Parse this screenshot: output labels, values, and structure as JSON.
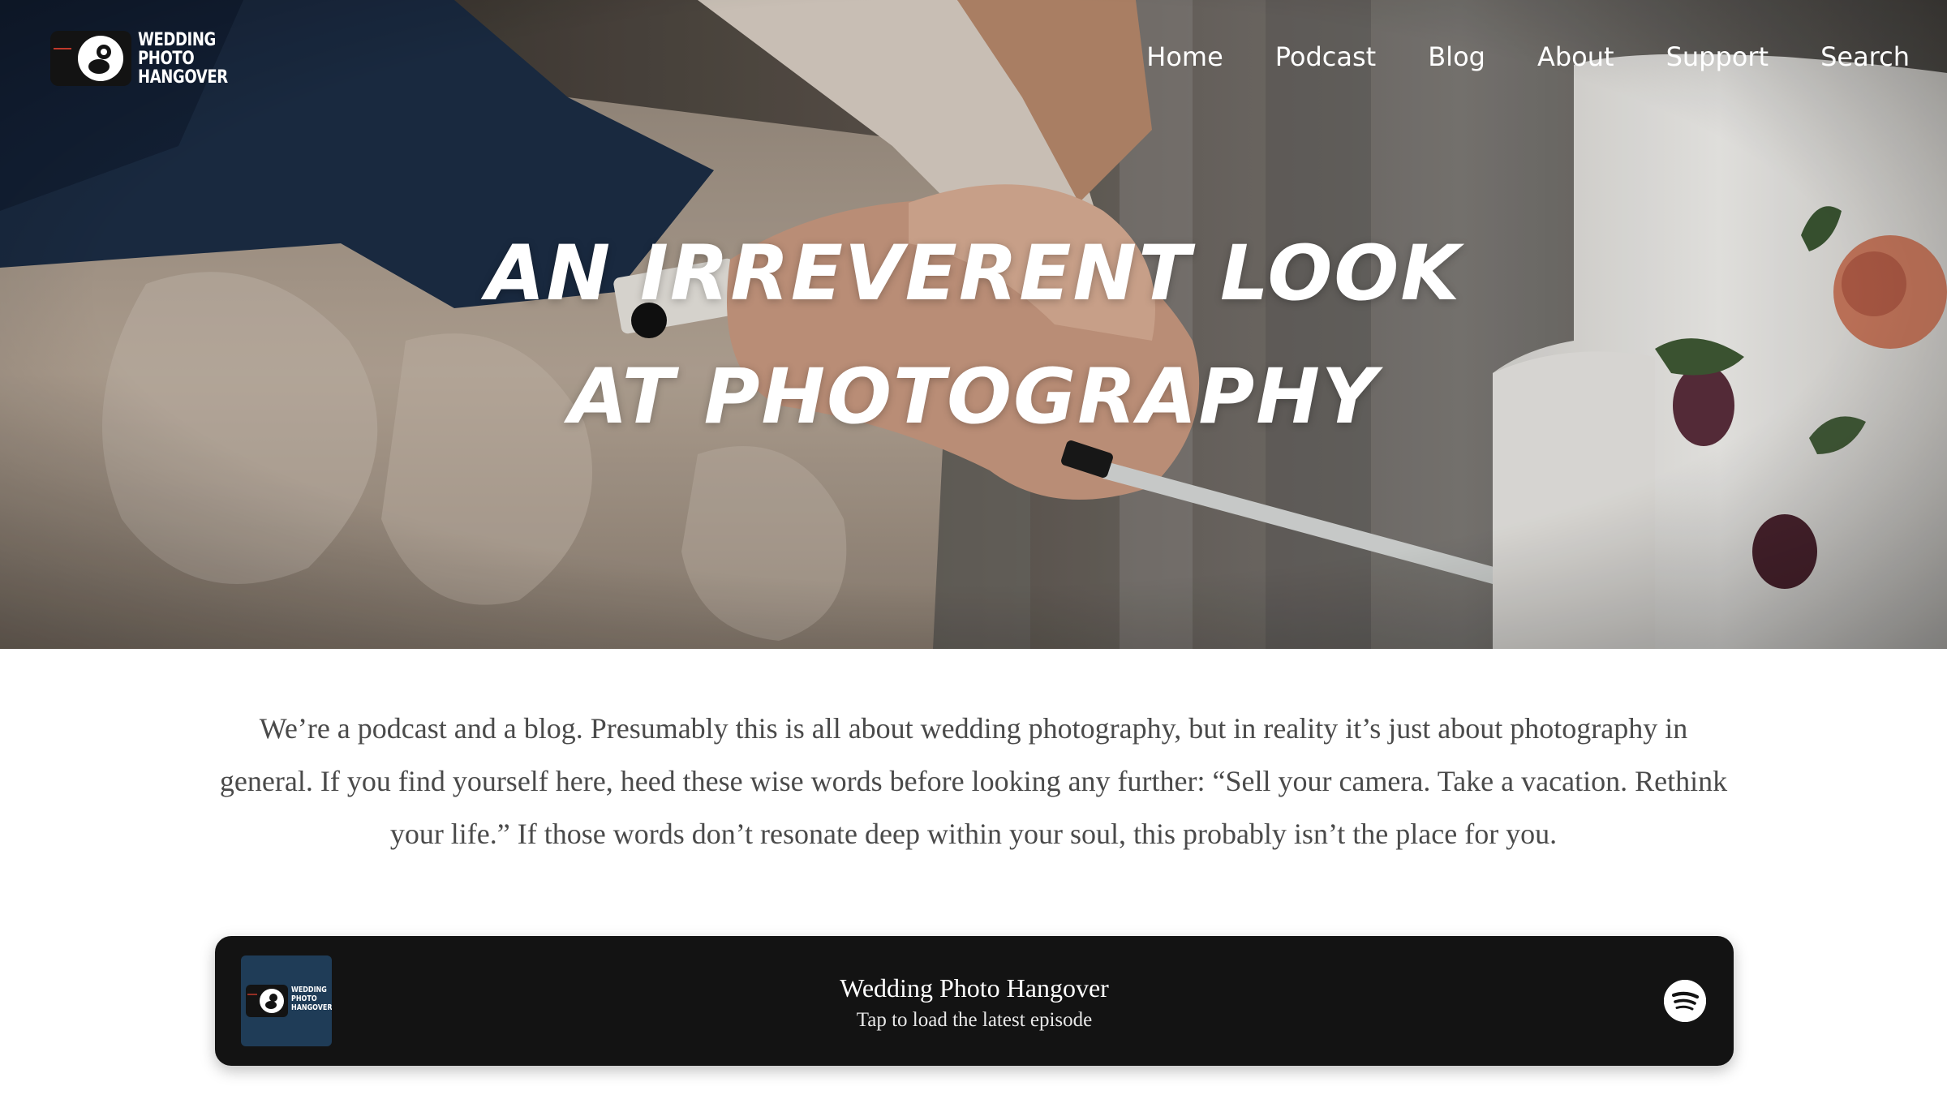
{
  "logo": {
    "lines": [
      "WEDDING",
      "PHOTO",
      "HANGOVER"
    ],
    "icon": "camera-logo-icon"
  },
  "nav": {
    "items": [
      "Home",
      "Podcast",
      "Blog",
      "About",
      "Support",
      "Search"
    ]
  },
  "hero": {
    "headline": "AN IRREVERENT LOOK AT PHOTOGRAPHY",
    "image": "bride-and-groom-cutting-cake-photo"
  },
  "intro": {
    "text": "We’re a podcast and a blog. Presumably this is all about wedding photography, but in reality it’s just about photography in general. If you find yourself here, heed these wise words before looking any further: “Sell your camera. Take a vacation. Rethink your life.” If those words don’t resonate deep within your soul, this probably isn’t the place for you."
  },
  "player": {
    "title": "Wedding Photo Hangover",
    "subtitle": "Tap to load the latest episode",
    "art_lines": [
      "WEDDING",
      "PHOTO",
      "HANGOVER"
    ],
    "spotify_icon": "spotify-icon"
  },
  "colors": {
    "player_bg": "#131313",
    "art_bg": "#1f3c57",
    "text_body": "#4a4a4a"
  }
}
